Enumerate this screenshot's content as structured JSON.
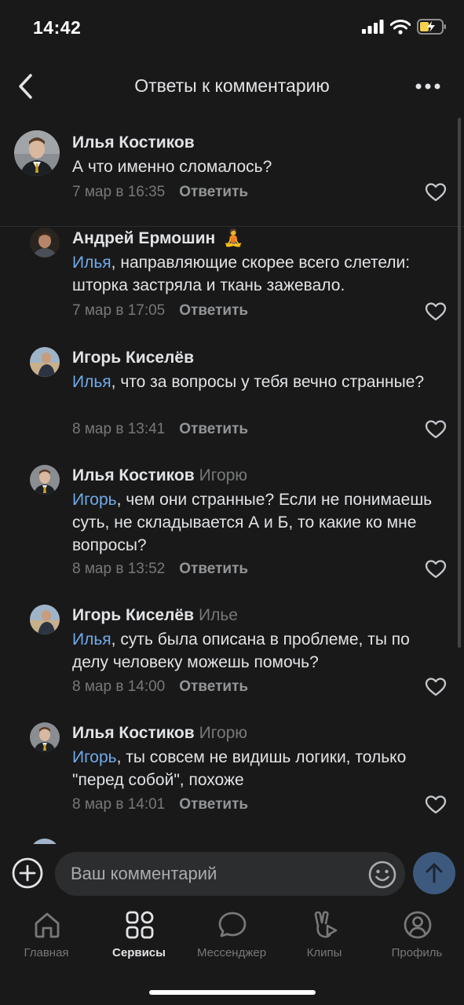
{
  "status_bar": {
    "time": "14:42"
  },
  "header": {
    "title": "Ответы к комментарию",
    "back_icon": "chevron-left-icon",
    "more_icon": "more-horizontal-icon"
  },
  "comments": [
    {
      "author": "Илья Костиков",
      "reply_to": "",
      "mention": "",
      "text": "А что именно сломалось?",
      "date": "7 мар в 16:35",
      "reply_label": "Ответить"
    },
    {
      "author": "Андрей Ермошин",
      "author_emoji": "🧘",
      "reply_to": "",
      "mention": "Илья",
      "text": ", направляющие скорее всего слетели: шторка застряла и ткань зажевало.",
      "date": "7 мар в 17:05",
      "reply_label": "Ответить"
    },
    {
      "author": "Игорь Киселёв",
      "reply_to": "",
      "mention": "Илья",
      "text": ", что за вопросы у тебя вечно странные?",
      "date": "8 мар в 13:41",
      "reply_label": "Ответить"
    },
    {
      "author": "Илья Костиков",
      "reply_to": "Игорю",
      "mention": "Игорь",
      "text": ", чем они странные? Если не понимаешь суть, не складывается А и Б, то какие ко мне вопросы?",
      "date": "8 мар в 13:52",
      "reply_label": "Ответить"
    },
    {
      "author": "Игорь Киселёв",
      "reply_to": "Илье",
      "mention": "Илья",
      "text": ", суть была описана в проблеме, ты по делу человеку можешь помочь?",
      "date": "8 мар в 14:00",
      "reply_label": "Ответить"
    },
    {
      "author": "Илья Костиков",
      "reply_to": "Игорю",
      "mention": "Игорь",
      "text": ", ты совсем не видишь логики, только \"перед собой\", похоже",
      "date": "8 мар в 14:01",
      "reply_label": "Ответить"
    }
  ],
  "composer": {
    "placeholder": "Ваш комментарий",
    "add_icon": "plus-circle-icon",
    "emoji_icon": "smile-icon",
    "send_icon": "arrow-up-icon"
  },
  "tabs": [
    {
      "label": "Главная",
      "icon": "home-icon",
      "active": false
    },
    {
      "label": "Сервисы",
      "icon": "services-grid-icon",
      "active": true
    },
    {
      "label": "Мессенджер",
      "icon": "message-bubble-icon",
      "active": false
    },
    {
      "label": "Клипы",
      "icon": "clips-icon",
      "active": false
    },
    {
      "label": "Профиль",
      "icon": "profile-icon",
      "active": false
    }
  ],
  "colors": {
    "background": "#191919",
    "text": "#e1e3e6",
    "secondary": "#76787a",
    "mention": "#71aaeb",
    "send_button": "#3d5a7e"
  }
}
